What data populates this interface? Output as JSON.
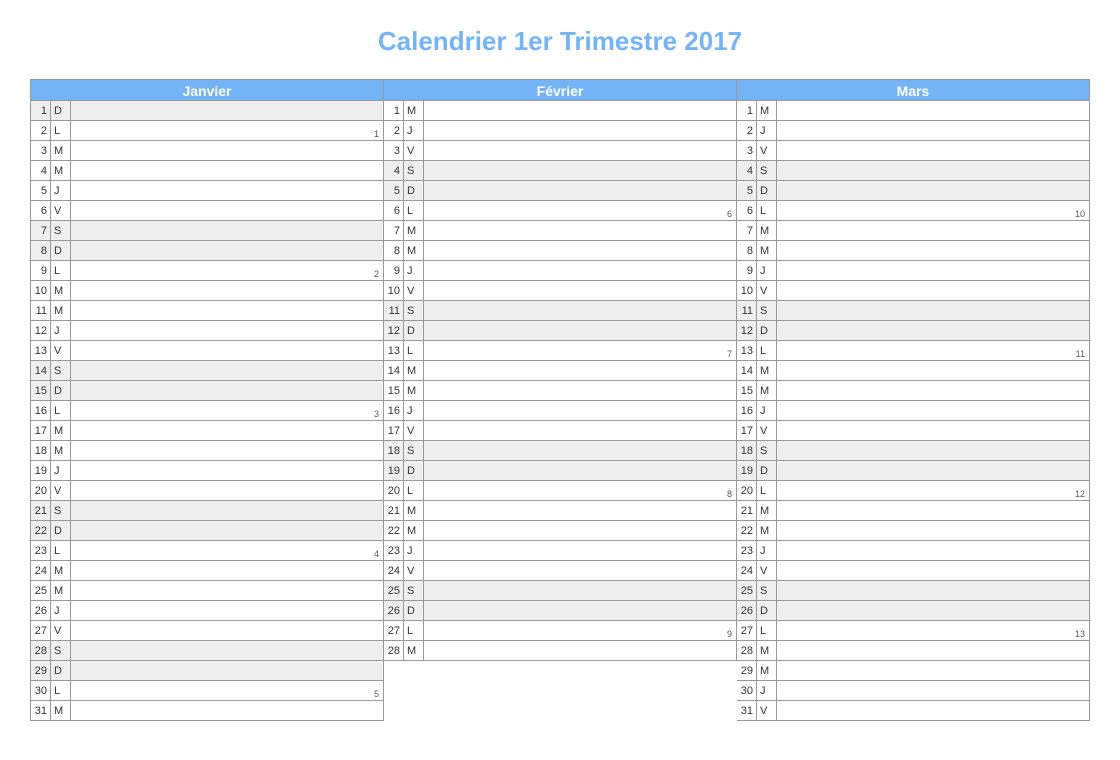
{
  "title": "Calendrier 1er Trimestre 2017",
  "colors": {
    "accent": "#74b4f6"
  },
  "months": [
    {
      "name": "Janvier",
      "days": [
        {
          "num": 1,
          "dow": "D",
          "shaded": true,
          "week": ""
        },
        {
          "num": 2,
          "dow": "L",
          "shaded": false,
          "week": "1"
        },
        {
          "num": 3,
          "dow": "M",
          "shaded": false,
          "week": ""
        },
        {
          "num": 4,
          "dow": "M",
          "shaded": false,
          "week": ""
        },
        {
          "num": 5,
          "dow": "J",
          "shaded": false,
          "week": ""
        },
        {
          "num": 6,
          "dow": "V",
          "shaded": false,
          "week": ""
        },
        {
          "num": 7,
          "dow": "S",
          "shaded": true,
          "week": ""
        },
        {
          "num": 8,
          "dow": "D",
          "shaded": true,
          "week": ""
        },
        {
          "num": 9,
          "dow": "L",
          "shaded": false,
          "week": "2"
        },
        {
          "num": 10,
          "dow": "M",
          "shaded": false,
          "week": ""
        },
        {
          "num": 11,
          "dow": "M",
          "shaded": false,
          "week": ""
        },
        {
          "num": 12,
          "dow": "J",
          "shaded": false,
          "week": ""
        },
        {
          "num": 13,
          "dow": "V",
          "shaded": false,
          "week": ""
        },
        {
          "num": 14,
          "dow": "S",
          "shaded": true,
          "week": ""
        },
        {
          "num": 15,
          "dow": "D",
          "shaded": true,
          "week": ""
        },
        {
          "num": 16,
          "dow": "L",
          "shaded": false,
          "week": "3"
        },
        {
          "num": 17,
          "dow": "M",
          "shaded": false,
          "week": ""
        },
        {
          "num": 18,
          "dow": "M",
          "shaded": false,
          "week": ""
        },
        {
          "num": 19,
          "dow": "J",
          "shaded": false,
          "week": ""
        },
        {
          "num": 20,
          "dow": "V",
          "shaded": false,
          "week": ""
        },
        {
          "num": 21,
          "dow": "S",
          "shaded": true,
          "week": ""
        },
        {
          "num": 22,
          "dow": "D",
          "shaded": true,
          "week": ""
        },
        {
          "num": 23,
          "dow": "L",
          "shaded": false,
          "week": "4"
        },
        {
          "num": 24,
          "dow": "M",
          "shaded": false,
          "week": ""
        },
        {
          "num": 25,
          "dow": "M",
          "shaded": false,
          "week": ""
        },
        {
          "num": 26,
          "dow": "J",
          "shaded": false,
          "week": ""
        },
        {
          "num": 27,
          "dow": "V",
          "shaded": false,
          "week": ""
        },
        {
          "num": 28,
          "dow": "S",
          "shaded": true,
          "week": ""
        },
        {
          "num": 29,
          "dow": "D",
          "shaded": true,
          "week": ""
        },
        {
          "num": 30,
          "dow": "L",
          "shaded": false,
          "week": "5"
        },
        {
          "num": 31,
          "dow": "M",
          "shaded": false,
          "week": ""
        }
      ]
    },
    {
      "name": "Février",
      "days": [
        {
          "num": 1,
          "dow": "M",
          "shaded": false,
          "week": ""
        },
        {
          "num": 2,
          "dow": "J",
          "shaded": false,
          "week": ""
        },
        {
          "num": 3,
          "dow": "V",
          "shaded": false,
          "week": ""
        },
        {
          "num": 4,
          "dow": "S",
          "shaded": true,
          "week": ""
        },
        {
          "num": 5,
          "dow": "D",
          "shaded": true,
          "week": ""
        },
        {
          "num": 6,
          "dow": "L",
          "shaded": false,
          "week": "6"
        },
        {
          "num": 7,
          "dow": "M",
          "shaded": false,
          "week": ""
        },
        {
          "num": 8,
          "dow": "M",
          "shaded": false,
          "week": ""
        },
        {
          "num": 9,
          "dow": "J",
          "shaded": false,
          "week": ""
        },
        {
          "num": 10,
          "dow": "V",
          "shaded": false,
          "week": ""
        },
        {
          "num": 11,
          "dow": "S",
          "shaded": true,
          "week": ""
        },
        {
          "num": 12,
          "dow": "D",
          "shaded": true,
          "week": ""
        },
        {
          "num": 13,
          "dow": "L",
          "shaded": false,
          "week": "7"
        },
        {
          "num": 14,
          "dow": "M",
          "shaded": false,
          "week": ""
        },
        {
          "num": 15,
          "dow": "M",
          "shaded": false,
          "week": ""
        },
        {
          "num": 16,
          "dow": "J",
          "shaded": false,
          "week": ""
        },
        {
          "num": 17,
          "dow": "V",
          "shaded": false,
          "week": ""
        },
        {
          "num": 18,
          "dow": "S",
          "shaded": true,
          "week": ""
        },
        {
          "num": 19,
          "dow": "D",
          "shaded": true,
          "week": ""
        },
        {
          "num": 20,
          "dow": "L",
          "shaded": false,
          "week": "8"
        },
        {
          "num": 21,
          "dow": "M",
          "shaded": false,
          "week": ""
        },
        {
          "num": 22,
          "dow": "M",
          "shaded": false,
          "week": ""
        },
        {
          "num": 23,
          "dow": "J",
          "shaded": false,
          "week": ""
        },
        {
          "num": 24,
          "dow": "V",
          "shaded": false,
          "week": ""
        },
        {
          "num": 25,
          "dow": "S",
          "shaded": true,
          "week": ""
        },
        {
          "num": 26,
          "dow": "D",
          "shaded": true,
          "week": ""
        },
        {
          "num": 27,
          "dow": "L",
          "shaded": false,
          "week": "9"
        },
        {
          "num": 28,
          "dow": "M",
          "shaded": false,
          "week": ""
        }
      ]
    },
    {
      "name": "Mars",
      "days": [
        {
          "num": 1,
          "dow": "M",
          "shaded": false,
          "week": ""
        },
        {
          "num": 2,
          "dow": "J",
          "shaded": false,
          "week": ""
        },
        {
          "num": 3,
          "dow": "V",
          "shaded": false,
          "week": ""
        },
        {
          "num": 4,
          "dow": "S",
          "shaded": true,
          "week": ""
        },
        {
          "num": 5,
          "dow": "D",
          "shaded": true,
          "week": ""
        },
        {
          "num": 6,
          "dow": "L",
          "shaded": false,
          "week": "10"
        },
        {
          "num": 7,
          "dow": "M",
          "shaded": false,
          "week": ""
        },
        {
          "num": 8,
          "dow": "M",
          "shaded": false,
          "week": ""
        },
        {
          "num": 9,
          "dow": "J",
          "shaded": false,
          "week": ""
        },
        {
          "num": 10,
          "dow": "V",
          "shaded": false,
          "week": ""
        },
        {
          "num": 11,
          "dow": "S",
          "shaded": true,
          "week": ""
        },
        {
          "num": 12,
          "dow": "D",
          "shaded": true,
          "week": ""
        },
        {
          "num": 13,
          "dow": "L",
          "shaded": false,
          "week": "11"
        },
        {
          "num": 14,
          "dow": "M",
          "shaded": false,
          "week": ""
        },
        {
          "num": 15,
          "dow": "M",
          "shaded": false,
          "week": ""
        },
        {
          "num": 16,
          "dow": "J",
          "shaded": false,
          "week": ""
        },
        {
          "num": 17,
          "dow": "V",
          "shaded": false,
          "week": ""
        },
        {
          "num": 18,
          "dow": "S",
          "shaded": true,
          "week": ""
        },
        {
          "num": 19,
          "dow": "D",
          "shaded": true,
          "week": ""
        },
        {
          "num": 20,
          "dow": "L",
          "shaded": false,
          "week": "12"
        },
        {
          "num": 21,
          "dow": "M",
          "shaded": false,
          "week": ""
        },
        {
          "num": 22,
          "dow": "M",
          "shaded": false,
          "week": ""
        },
        {
          "num": 23,
          "dow": "J",
          "shaded": false,
          "week": ""
        },
        {
          "num": 24,
          "dow": "V",
          "shaded": false,
          "week": ""
        },
        {
          "num": 25,
          "dow": "S",
          "shaded": true,
          "week": ""
        },
        {
          "num": 26,
          "dow": "D",
          "shaded": true,
          "week": ""
        },
        {
          "num": 27,
          "dow": "L",
          "shaded": false,
          "week": "13"
        },
        {
          "num": 28,
          "dow": "M",
          "shaded": false,
          "week": ""
        },
        {
          "num": 29,
          "dow": "M",
          "shaded": false,
          "week": ""
        },
        {
          "num": 30,
          "dow": "J",
          "shaded": false,
          "week": ""
        },
        {
          "num": 31,
          "dow": "V",
          "shaded": false,
          "week": ""
        }
      ]
    }
  ]
}
